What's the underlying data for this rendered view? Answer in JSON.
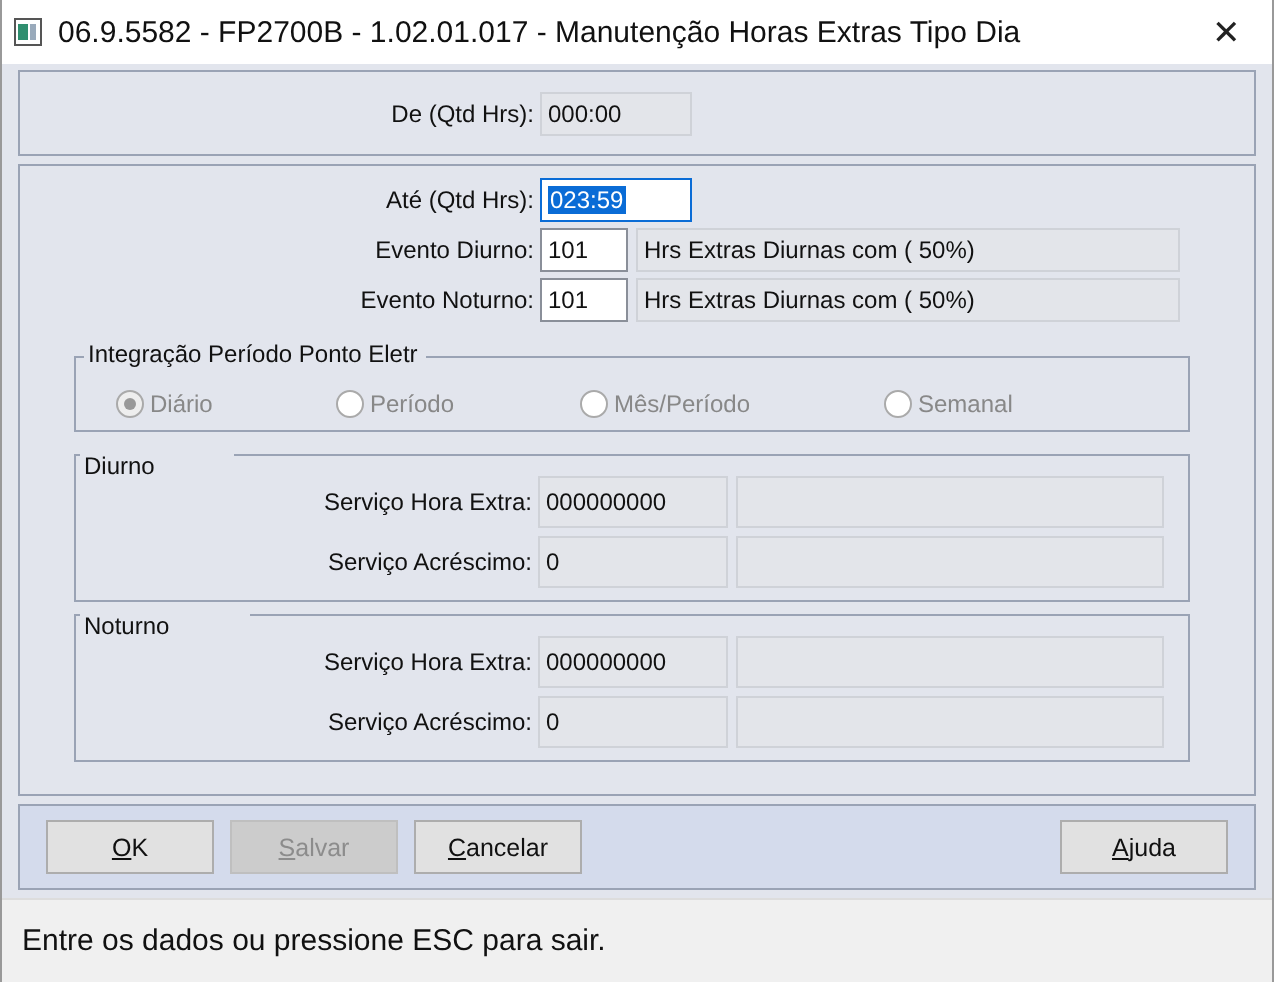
{
  "window": {
    "title": "06.9.5582 - FP2700B - 1.02.01.017 - Manutenção Horas Extras Tipo Dia",
    "close": "✕"
  },
  "header": {
    "label": "De (Qtd Hrs):",
    "value": "000:00",
    "disabled": true
  },
  "main": {
    "ate": {
      "label": "Até (Qtd Hrs):",
      "value": "023:59",
      "selected": true
    },
    "events": [
      {
        "label": "Evento Diurno:",
        "code": "101",
        "description": "Hrs Extras Diurnas  com ( 50%)"
      },
      {
        "label": "Evento Noturno:",
        "code": "101",
        "description": "Hrs Extras Diurnas  com ( 50%)"
      }
    ],
    "integration": {
      "title": "Integração Período Ponto Eletr",
      "options": [
        {
          "label": "Diário",
          "selected": true
        },
        {
          "label": "Período",
          "selected": false
        },
        {
          "label": "Mês/Período",
          "selected": false
        },
        {
          "label": "Semanal",
          "selected": false
        }
      ]
    },
    "groups": [
      {
        "title": "Diurno",
        "rows": [
          {
            "label": "Serviço Hora Extra:",
            "value": "000000000"
          },
          {
            "label": "Serviço Acréscimo:",
            "value": "0"
          }
        ]
      },
      {
        "title": "Noturno",
        "rows": [
          {
            "label": "Serviço Hora Extra:",
            "value": "000000000"
          },
          {
            "label": "Serviço Acréscimo:",
            "value": "0"
          }
        ]
      }
    ]
  },
  "buttons": [
    {
      "label": "OK",
      "disabled": false,
      "mnemonic": true
    },
    {
      "label": "Salvar",
      "disabled": true,
      "mnemonic": true
    },
    {
      "label": "Cancelar",
      "disabled": false,
      "mnemonic": true
    },
    {
      "label": "Ajuda",
      "disabled": false,
      "mnemonic": true
    }
  ],
  "status_bar": "Entre os dados ou pressione ESC para sair."
}
